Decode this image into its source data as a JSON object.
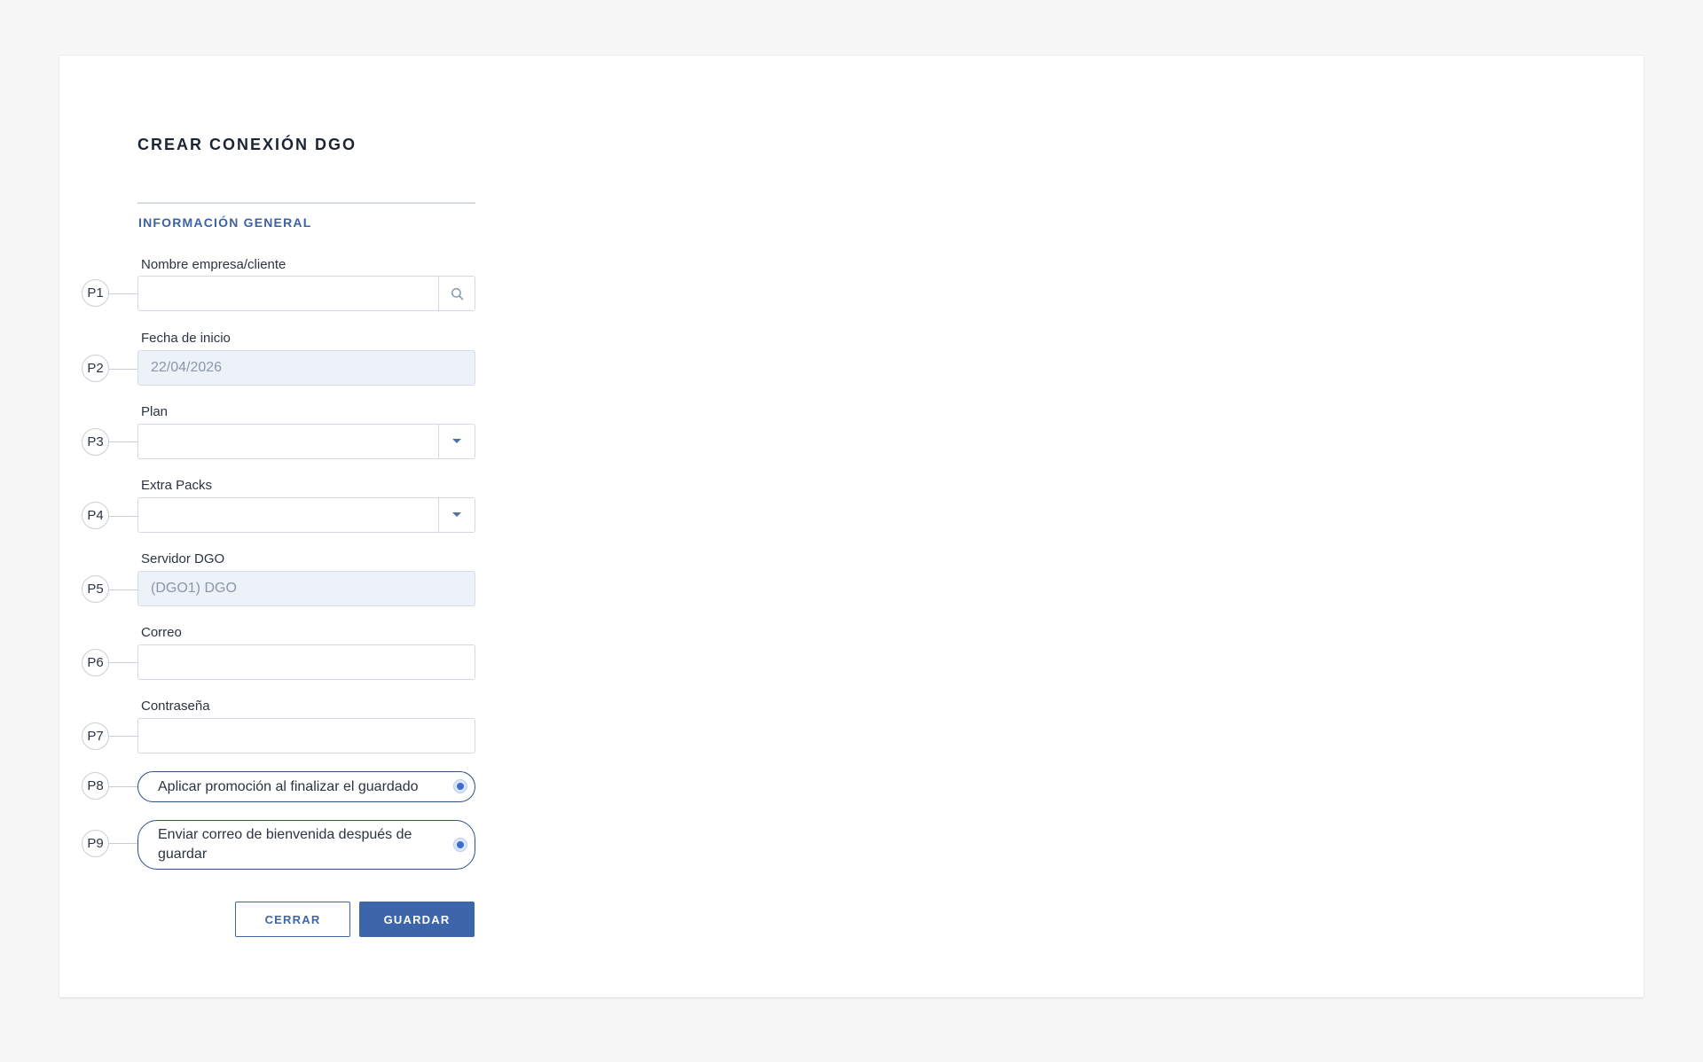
{
  "form": {
    "title": "CREAR CONEXIÓN DGO",
    "section_title": "INFORMACIÓN GENERAL"
  },
  "fields": {
    "company": {
      "marker": "P1",
      "label": "Nombre empresa/cliente",
      "value": "",
      "icon": "search-icon"
    },
    "start_date": {
      "marker": "P2",
      "label": "Fecha de inicio",
      "value": "22/04/2026"
    },
    "plan": {
      "marker": "P3",
      "label": "Plan",
      "value": "",
      "icon": "caret-down-icon"
    },
    "extra_packs": {
      "marker": "P4",
      "label": "Extra Packs",
      "value": "",
      "icon": "caret-down-icon"
    },
    "server": {
      "marker": "P5",
      "label": "Servidor DGO",
      "value": "(DGO1) DGO"
    },
    "email": {
      "marker": "P6",
      "label": "Correo",
      "value": ""
    },
    "password": {
      "marker": "P7",
      "label": "Contraseña",
      "value": ""
    }
  },
  "options": {
    "promotion": {
      "marker": "P8",
      "label": "Aplicar promoción al finalizar el guardado",
      "selected": true
    },
    "welcome_email": {
      "marker": "P9",
      "label": "Enviar correo de bienvenida después de guardar",
      "selected": true
    }
  },
  "actions": {
    "close_label": "CERRAR",
    "save_label": "GUARDAR"
  },
  "colors": {
    "accent": "#3d65aa",
    "section_title": "#3d62a3",
    "disabled_field_bg": "#edf1f8",
    "page_bg": "#f7f7f7"
  }
}
